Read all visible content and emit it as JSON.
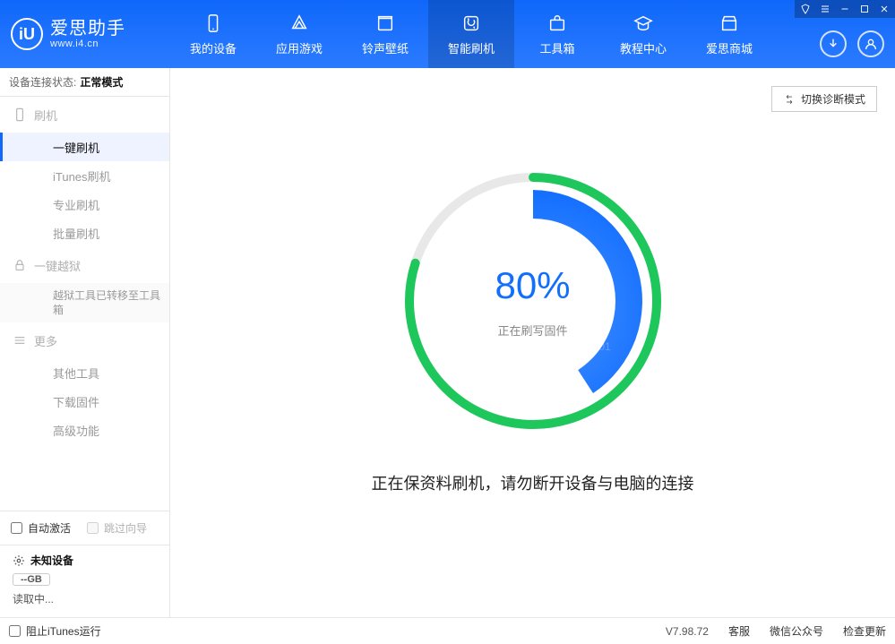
{
  "brand": {
    "title": "爱思助手",
    "url": "www.i4.cn",
    "logo_letters": "iU"
  },
  "colors": {
    "accent": "#1069fc",
    "ring_green": "#1ec75b",
    "ring_blue": "#0e6bff"
  },
  "nav": {
    "items": [
      {
        "label": "我的设备"
      },
      {
        "label": "应用游戏"
      },
      {
        "label": "铃声壁纸"
      },
      {
        "label": "智能刷机",
        "active": true
      },
      {
        "label": "工具箱"
      },
      {
        "label": "教程中心"
      },
      {
        "label": "爱思商城"
      }
    ]
  },
  "header_buttons": {
    "download": "download-icon",
    "user": "user-icon"
  },
  "window_controls": [
    "t-shirt-icon",
    "list-icon",
    "minimize-icon",
    "maximize-icon",
    "close-icon"
  ],
  "connection_status": {
    "label": "设备连接状态:",
    "value": "正常模式"
  },
  "sidebar": {
    "sections": [
      {
        "header": "刷机",
        "icon": "phone-icon",
        "items": [
          {
            "label": "一键刷机",
            "active": true
          },
          {
            "label": "iTunes刷机"
          },
          {
            "label": "专业刷机"
          },
          {
            "label": "批量刷机"
          }
        ]
      },
      {
        "header": "一键越狱",
        "icon": "lock-icon",
        "items": [
          {
            "label": "越狱工具已转移至工具箱",
            "info": true
          }
        ]
      },
      {
        "header": "更多",
        "icon": "menu-icon",
        "items": [
          {
            "label": "其他工具"
          },
          {
            "label": "下载固件"
          },
          {
            "label": "高级功能"
          }
        ]
      }
    ],
    "bottom_options": {
      "auto_activate": "自动激活",
      "skip_guide": "跳过向导"
    },
    "device": {
      "name": "未知设备",
      "storage": "--GB",
      "reading": "读取中..."
    }
  },
  "diag_button": "切换诊断模式",
  "progress": {
    "percent_text": "80%",
    "percent_value": 80,
    "caption": "正在刷写固件"
  },
  "main_message": "正在保资料刷机，请勿断开设备与电脑的连接",
  "footer": {
    "block_itunes": "阻止iTunes运行",
    "version": "V7.98.72",
    "links": [
      "客服",
      "微信公众号",
      "检查更新"
    ]
  }
}
